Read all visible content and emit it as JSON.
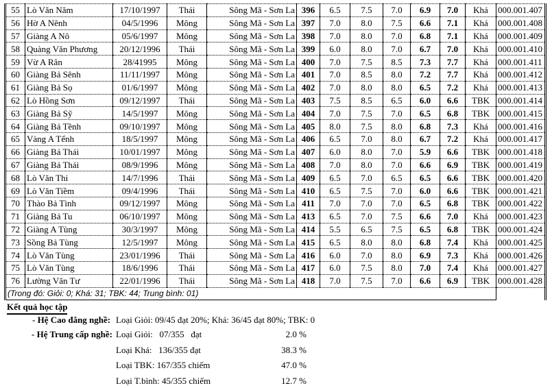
{
  "rows": [
    [
      "55",
      "Lò Văn Năm",
      "17/10/1997",
      "Thái",
      "Sông Mã - Sơn La",
      "396",
      "6.5",
      "7.5",
      "7.0",
      "6.9",
      "7.0",
      "Khá",
      "000.001.407"
    ],
    [
      "56",
      "Hờ A Nênh",
      "04/5/1996",
      "Mông",
      "Sông Mã - Sơn La",
      "397",
      "7.0",
      "8.0",
      "7.5",
      "6.6",
      "7.1",
      "Khá",
      "000.001.408"
    ],
    [
      "57",
      "Giàng A Nô",
      "05/6/1997",
      "Mông",
      "Sông Mã - Sơn La",
      "398",
      "7.0",
      "8.0",
      "7.0",
      "6.8",
      "7.1",
      "Khá",
      "000.001.409"
    ],
    [
      "58",
      "Quàng Văn Phương",
      "20/12/1996",
      "Thái",
      "Sông Mã - Sơn La",
      "399",
      "6.0",
      "8.0",
      "7.0",
      "6.7",
      "7.0",
      "Khá",
      "000.001.410"
    ],
    [
      "59",
      "Vừ A Rân",
      "28/41995",
      "Mông",
      "Sông Mã - Sơn La",
      "400",
      "7.0",
      "7.5",
      "8.5",
      "7.3",
      "7.7",
      "Khá",
      "000.001.411"
    ],
    [
      "60",
      "Giàng Bả Sênh",
      "11/11/1997",
      "Mông",
      "Sông Mã - Sơn La",
      "401",
      "7.0",
      "8.5",
      "8.0",
      "7.2",
      "7.7",
      "Khá",
      "000.001.412"
    ],
    [
      "61",
      "Giàng Bả Sọ",
      "01/6/1997",
      "Mông",
      "Sông Mã - Sơn La",
      "402",
      "7.0",
      "8.0",
      "8.0",
      "6.5",
      "7.2",
      "Khá",
      "000.001.413"
    ],
    [
      "62",
      "Lò Hồng Sơn",
      "09/12/1997",
      "Thái",
      "Sông Mã - Sơn La",
      "403",
      "7.5",
      "8.5",
      "6.5",
      "6.0",
      "6.6",
      "TBK",
      "000.001.414"
    ],
    [
      "63",
      "Giàng Bả Sỹ",
      "14/5/1997",
      "Mông",
      "Sông Mã - Sơn La",
      "404",
      "7.0",
      "7.5",
      "7.0",
      "6.5",
      "6.8",
      "TBK",
      "000.001.415"
    ],
    [
      "64",
      "Giàng Bả Tềnh",
      "09/10/1997",
      "Mông",
      "Sông Mã - Sơn La",
      "405",
      "8.0",
      "7.5",
      "8.0",
      "6.8",
      "7.3",
      "Khá",
      "000.001.416"
    ],
    [
      "65",
      "Vàng A Tểnh",
      "18/5/1997",
      "Mông",
      "Sông Mã - Sơn La",
      "406",
      "6.5",
      "7.0",
      "8.0",
      "6.7",
      "7.2",
      "Khá",
      "000.001.417"
    ],
    [
      "66",
      "Giàng Bả Thái",
      "10/01/1997",
      "Mông",
      "Sông Mã - Sơn La",
      "407",
      "6.0",
      "8.0",
      "7.0",
      "5.9",
      "6.6",
      "TBK",
      "000.001.418"
    ],
    [
      "67",
      "Giàng Bả Thái",
      "08/9/1996",
      "Mông",
      "Sông Mã - Sơn La",
      "408",
      "7.0",
      "8.0",
      "7.0",
      "6.6",
      "6.9",
      "TBK",
      "000.001.419"
    ],
    [
      "68",
      "Lò Văn Thi",
      "14/7/1996",
      "Thái",
      "Sông Mã - Sơn La",
      "409",
      "6.5",
      "7.0",
      "6.5",
      "6.5",
      "6.6",
      "TBK",
      "000.001.420"
    ],
    [
      "69",
      "Lò Văn Tiềm",
      "09/4/1996",
      "Thái",
      "Sông Mã - Sơn La",
      "410",
      "6.5",
      "7.5",
      "7.0",
      "6.0",
      "6.6",
      "TBK",
      "000.001.421"
    ],
    [
      "70",
      "Thào Bả Tình",
      "09/12/1997",
      "Mông",
      "Sông Mã - Sơn La",
      "411",
      "7.0",
      "7.0",
      "7.0",
      "6.5",
      "6.8",
      "TBK",
      "000.001.422"
    ],
    [
      "71",
      "Giàng Bả Tu",
      "06/10/1997",
      "Mông",
      "Sông Mã - Sơn La",
      "413",
      "6.5",
      "7.0",
      "7.5",
      "6.6",
      "7.0",
      "Khá",
      "000.001.423"
    ],
    [
      "72",
      "Giàng A Tùng",
      "30/3/1997",
      "Mông",
      "Sông Mã - Sơn La",
      "414",
      "5.5",
      "6.5",
      "7.5",
      "6.5",
      "6.8",
      "TBK",
      "000.001.424"
    ],
    [
      "73",
      "Sồng Bả Tùng",
      "12/5/1997",
      "Mông",
      "Sông Mã - Sơn La",
      "415",
      "6.5",
      "8.0",
      "8.0",
      "6.8",
      "7.4",
      "Khá",
      "000.001.425"
    ],
    [
      "74",
      "Lò Văn Tùng",
      "23/01/1996",
      "Thái",
      "Sông Mã - Sơn La",
      "416",
      "6.0",
      "7.0",
      "8.0",
      "6.9",
      "7.3",
      "Khá",
      "000.001.426"
    ],
    [
      "75",
      "Lò Văn Tùng",
      "18/6/1996",
      "Thái",
      "Sông Mã - Sơn La",
      "417",
      "6.0",
      "7.5",
      "8.0",
      "7.0",
      "7.4",
      "Khá",
      "000.001.427"
    ],
    [
      "76",
      "Lường Văn Tư",
      "22/01/1996",
      "Thái",
      "Sông Mã - Sơn La",
      "418",
      "7.0",
      "7.5",
      "7.0",
      "6.6",
      "6.9",
      "TBK",
      "000.001.428"
    ]
  ],
  "note": "(Trong đó: Giỏi: 0; Khá: 31; TBK: 44; Trung bình: 01)",
  "summary": {
    "title": "Kết quả học tập",
    "cd_label": "- Hệ Cao đẳng nghề:",
    "cd_text": "Loại Giỏi: 09/45 đạt 20%; Khá: 36/45 đạt 80%; TBK: 0",
    "tc_label": "- Hệ Trung cấp nghề:",
    "lines": [
      {
        "text": "Loại Giỏi:   07/355   đạt",
        "pct": "2.0 %"
      },
      {
        "text": "Loại Khá:   136/355 đạt",
        "pct": "38.3 %"
      },
      {
        "text": "Loại TBK: 167/355 chiếm",
        "pct": "47.0 %"
      },
      {
        "text": "Loại T.bình: 45/355 chiếm",
        "pct": "12.7 %"
      }
    ]
  }
}
